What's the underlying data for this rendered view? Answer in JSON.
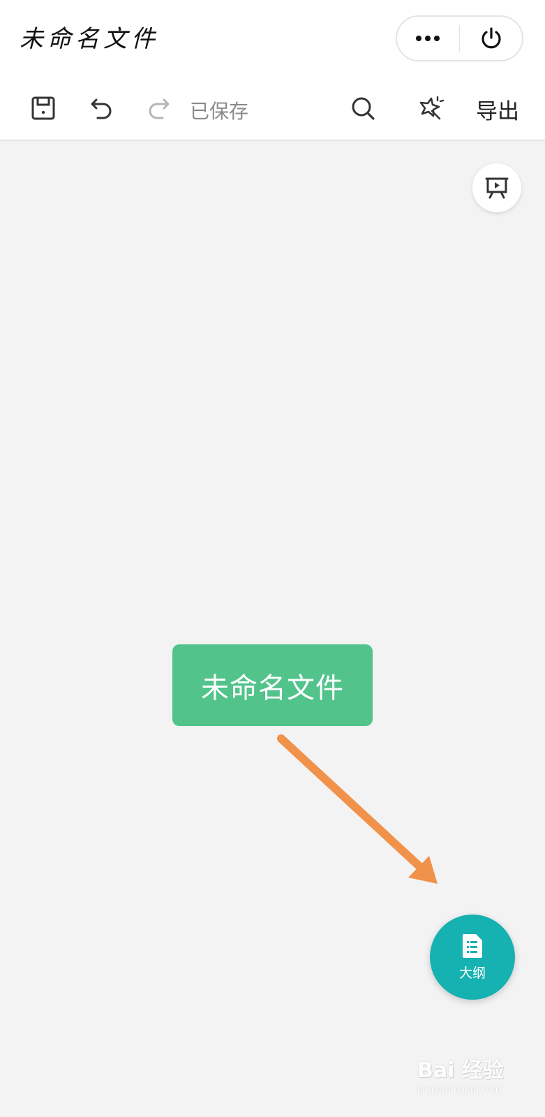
{
  "header": {
    "title": "未命名文件",
    "capsule": {
      "more_icon": "ellipsis-icon",
      "close_icon": "power-icon"
    }
  },
  "toolbar": {
    "save_icon": "floppy-disk-icon",
    "undo_icon": "undo-icon",
    "redo_icon": "redo-icon",
    "status": "已保存",
    "search_icon": "search-icon",
    "style_icon": "magic-wand-icon",
    "export_label": "导出"
  },
  "canvas": {
    "present_icon": "presentation-icon",
    "root_node_text": "未命名文件",
    "root_node_color": "#52c38b",
    "annotation_arrow_color": "#f0924a"
  },
  "outline_button": {
    "label": "大纲",
    "icon": "document-list-icon",
    "color": "#16b1b1"
  },
  "watermark": {
    "brand": "Bai 经验",
    "sub": "jingyan.baidu.com"
  }
}
